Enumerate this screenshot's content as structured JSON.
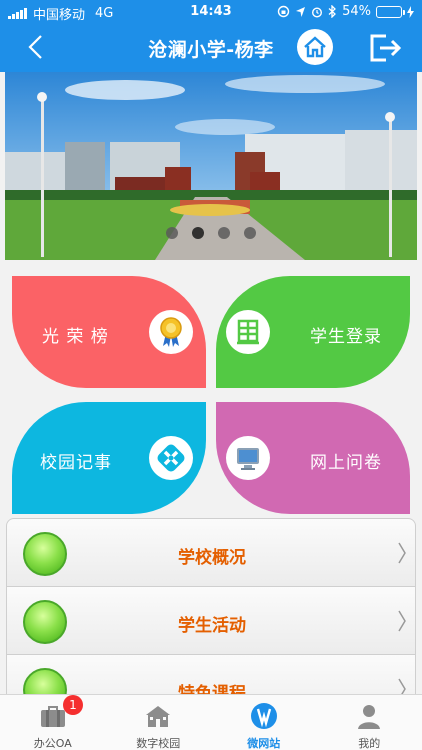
{
  "status_bar": {
    "carrier": "中国移动",
    "network": "4G",
    "time": "14:43",
    "battery": "54%",
    "battery_level": 0.54
  },
  "header": {
    "title": "沧澜小学-杨李",
    "back_icon": "chevron-left-icon",
    "home_icon": "home-icon",
    "logout_icon": "logout-icon"
  },
  "banner": {
    "slide_count": 4,
    "active_slide": 2
  },
  "tiles": [
    {
      "label": "光 荣 榜",
      "icon": "medal-icon",
      "color": "#fb6266"
    },
    {
      "label": "学生登录",
      "icon": "shelf-icon",
      "color": "#53c944"
    },
    {
      "label": "校园记事",
      "icon": "diamond-x-icon",
      "color": "#0db7e0"
    },
    {
      "label": "网上问卷",
      "icon": "monitor-icon",
      "color": "#d169b2"
    }
  ],
  "menu": [
    {
      "label": "学校概况"
    },
    {
      "label": "学生活动"
    },
    {
      "label": "特色课程"
    }
  ],
  "tabbar": {
    "tabs": [
      {
        "label": "办公OA",
        "icon": "briefcase-icon",
        "badge": "1"
      },
      {
        "label": "数字校园",
        "icon": "school-icon"
      },
      {
        "label": "微网站",
        "icon": "website-icon",
        "active": true
      },
      {
        "label": "我的",
        "icon": "user-icon"
      }
    ]
  },
  "colors": {
    "primary": "#1e8fe8",
    "accent_text": "#e45f00",
    "badge": "#f52f2f"
  }
}
